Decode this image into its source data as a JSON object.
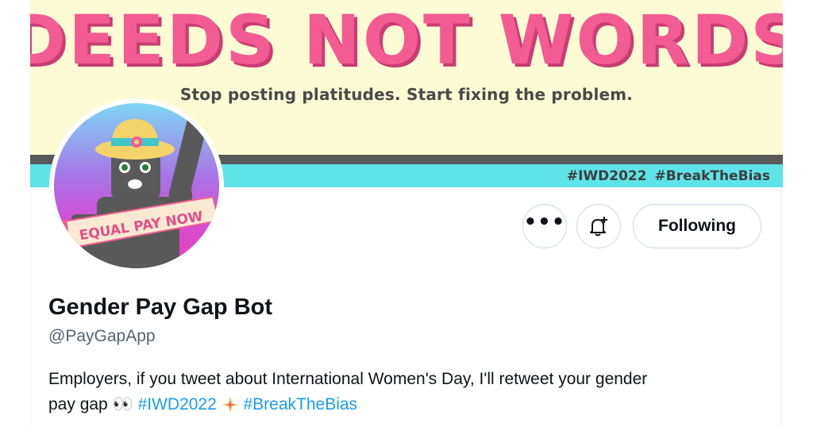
{
  "banner": {
    "headline": "DEEDS NOT WORDS",
    "subheadline": "Stop posting platitudes. Start fixing the problem.",
    "hashtags": "#IWD2022 #BreakTheBias",
    "headline_color": "#f25c92",
    "background_color": "#fdfbd4",
    "stripe_color": "#5ee4e8"
  },
  "avatar": {
    "sash_text": "EQUAL PAY NOW",
    "icon": "robot-with-sunhat-avatar"
  },
  "actions": {
    "more_icon": "more-horizontal-icon",
    "more_label": "•••",
    "notify_icon": "bell-plus-icon",
    "following_label": "Following"
  },
  "profile": {
    "display_name": "Gender Pay Gap Bot",
    "handle": "@PayGapApp",
    "bio_line1": "Employers, if you tweet about International Women's Day, I'll retweet your gender",
    "bio_line2_prefix": "pay gap",
    "bio_emoji_eyes": "👀",
    "bio_hashtag1": "#IWD2022",
    "bio_emoji_sparkle": "sparkle-star-emoji",
    "bio_hashtag2": "#BreakTheBias"
  },
  "colors": {
    "link": "#1d9bf0",
    "text_primary": "#0f1419",
    "text_secondary": "#536471",
    "border": "#cfd9de"
  }
}
